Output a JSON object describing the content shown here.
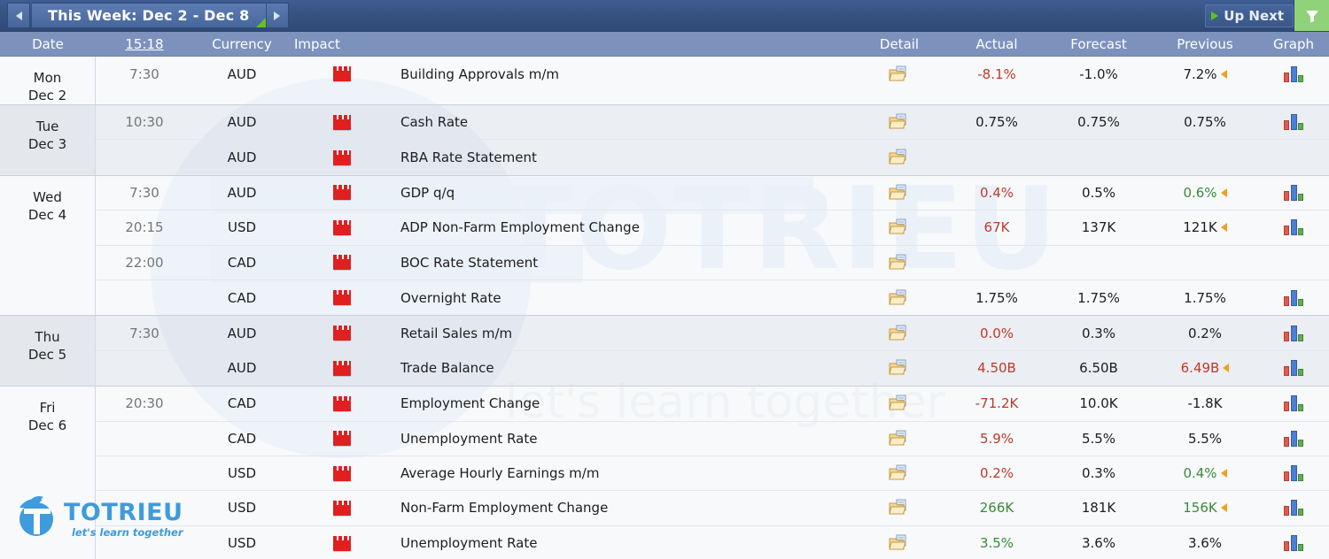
{
  "titlebar": {
    "prev_label": "prev-week-arrow",
    "next_label": "next-week-arrow",
    "week_title": "This Week: Dec 2 - Dec 8",
    "up_next_label": "Up Next",
    "filter_label": "filter-icon"
  },
  "columns": {
    "date": "Date",
    "time": "15:18",
    "currency": "Currency",
    "impact": "Impact",
    "event": "",
    "detail": "Detail",
    "actual": "Actual",
    "forecast": "Forecast",
    "previous": "Previous",
    "graph": "Graph"
  },
  "watermark": {
    "text": "TOTRIEU",
    "subtext": "let's learn together"
  },
  "brand": {
    "name": "TOTRIEU",
    "tagline": "let's learn together"
  },
  "days": [
    {
      "weekday": "Mon",
      "date": "Dec 2",
      "shade": "light",
      "rows": [
        {
          "time": "7:30",
          "currency": "AUD",
          "impact": "high",
          "event": "Building Approvals m/m",
          "actual": "-8.1%",
          "actual_color": "red",
          "forecast": "-1.0%",
          "previous": "7.2%",
          "previous_color": "black",
          "previous_revised": true,
          "graph": true
        }
      ]
    },
    {
      "weekday": "Tue",
      "date": "Dec 3",
      "shade": "shade",
      "rows": [
        {
          "time": "10:30",
          "currency": "AUD",
          "impact": "high",
          "event": "Cash Rate",
          "actual": "0.75%",
          "actual_color": "black",
          "forecast": "0.75%",
          "previous": "0.75%",
          "previous_color": "black",
          "previous_revised": false,
          "graph": true
        },
        {
          "time": "",
          "currency": "AUD",
          "impact": "high",
          "event": "RBA Rate Statement",
          "actual": "",
          "actual_color": "black",
          "forecast": "",
          "previous": "",
          "previous_color": "black",
          "previous_revised": false,
          "graph": false
        }
      ]
    },
    {
      "weekday": "Wed",
      "date": "Dec 4",
      "shade": "light",
      "rows": [
        {
          "time": "7:30",
          "currency": "AUD",
          "impact": "high",
          "event": "GDP q/q",
          "actual": "0.4%",
          "actual_color": "red",
          "forecast": "0.5%",
          "previous": "0.6%",
          "previous_color": "green",
          "previous_revised": true,
          "graph": true
        },
        {
          "time": "20:15",
          "currency": "USD",
          "impact": "high",
          "event": "ADP Non-Farm Employment Change",
          "actual": "67K",
          "actual_color": "red",
          "forecast": "137K",
          "previous": "121K",
          "previous_color": "black",
          "previous_revised": true,
          "graph": true
        },
        {
          "time": "22:00",
          "currency": "CAD",
          "impact": "high",
          "event": "BOC Rate Statement",
          "actual": "",
          "actual_color": "black",
          "forecast": "",
          "previous": "",
          "previous_color": "black",
          "previous_revised": false,
          "graph": false
        },
        {
          "time": "",
          "currency": "CAD",
          "impact": "high",
          "event": "Overnight Rate",
          "actual": "1.75%",
          "actual_color": "black",
          "forecast": "1.75%",
          "previous": "1.75%",
          "previous_color": "black",
          "previous_revised": false,
          "graph": true
        }
      ]
    },
    {
      "weekday": "Thu",
      "date": "Dec 5",
      "shade": "shade",
      "rows": [
        {
          "time": "7:30",
          "currency": "AUD",
          "impact": "high",
          "event": "Retail Sales m/m",
          "actual": "0.0%",
          "actual_color": "red",
          "forecast": "0.3%",
          "previous": "0.2%",
          "previous_color": "black",
          "previous_revised": false,
          "graph": true
        },
        {
          "time": "",
          "currency": "AUD",
          "impact": "high",
          "event": "Trade Balance",
          "actual": "4.50B",
          "actual_color": "red",
          "forecast": "6.50B",
          "previous": "6.49B",
          "previous_color": "red",
          "previous_revised": true,
          "graph": true
        }
      ]
    },
    {
      "weekday": "Fri",
      "date": "Dec 6",
      "shade": "light",
      "rows": [
        {
          "time": "20:30",
          "currency": "CAD",
          "impact": "high",
          "event": "Employment Change",
          "actual": "-71.2K",
          "actual_color": "red",
          "forecast": "10.0K",
          "previous": "-1.8K",
          "previous_color": "black",
          "previous_revised": false,
          "graph": true
        },
        {
          "time": "",
          "currency": "CAD",
          "impact": "high",
          "event": "Unemployment Rate",
          "actual": "5.9%",
          "actual_color": "red",
          "forecast": "5.5%",
          "previous": "5.5%",
          "previous_color": "black",
          "previous_revised": false,
          "graph": true
        },
        {
          "time": "",
          "currency": "USD",
          "impact": "high",
          "event": "Average Hourly Earnings m/m",
          "actual": "0.2%",
          "actual_color": "red",
          "forecast": "0.3%",
          "previous": "0.4%",
          "previous_color": "green",
          "previous_revised": true,
          "graph": true
        },
        {
          "time": "",
          "currency": "USD",
          "impact": "high",
          "event": "Non-Farm Employment Change",
          "actual": "266K",
          "actual_color": "green",
          "forecast": "181K",
          "previous": "156K",
          "previous_color": "green",
          "previous_revised": true,
          "graph": true
        },
        {
          "time": "",
          "currency": "USD",
          "impact": "high",
          "event": "Unemployment Rate",
          "actual": "3.5%",
          "actual_color": "green",
          "forecast": "3.6%",
          "previous": "3.6%",
          "previous_color": "black",
          "previous_revised": false,
          "graph": true
        }
      ]
    }
  ],
  "colors": {
    "header_bar": "#36527f",
    "column_header": "#7c92bd",
    "accent_green": "#8fd27a",
    "value_up": "#3a8a3a",
    "value_down": "#c0392b",
    "impact_high": "#e02020",
    "brand_blue": "#3e9bdc"
  }
}
